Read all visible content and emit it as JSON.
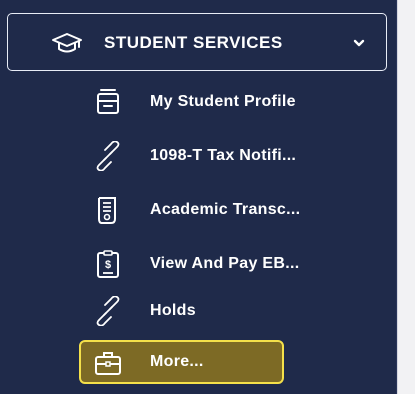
{
  "section": {
    "title": "STUDENT SERVICES",
    "icon": "graduation-cap-icon",
    "expand_icon": "chevron-down-icon"
  },
  "menu": {
    "items": [
      {
        "label": "My Student Profile",
        "icon": "profile-card-icon"
      },
      {
        "label": "1098-T Tax Notifi...",
        "icon": "link-icon"
      },
      {
        "label": "Academic Transc...",
        "icon": "transcript-scroll-icon"
      },
      {
        "label": "View And Pay EB...",
        "icon": "bill-clipboard-icon"
      },
      {
        "label": "Holds",
        "icon": "link-icon"
      },
      {
        "label": "More...",
        "icon": "briefcase-icon",
        "highlighted": true
      }
    ]
  },
  "colors": {
    "sidebar_bg": "#1f2a4a",
    "text": "#ffffff",
    "highlight_bg": "#7d6a25",
    "highlight_border": "#f4e04a"
  }
}
